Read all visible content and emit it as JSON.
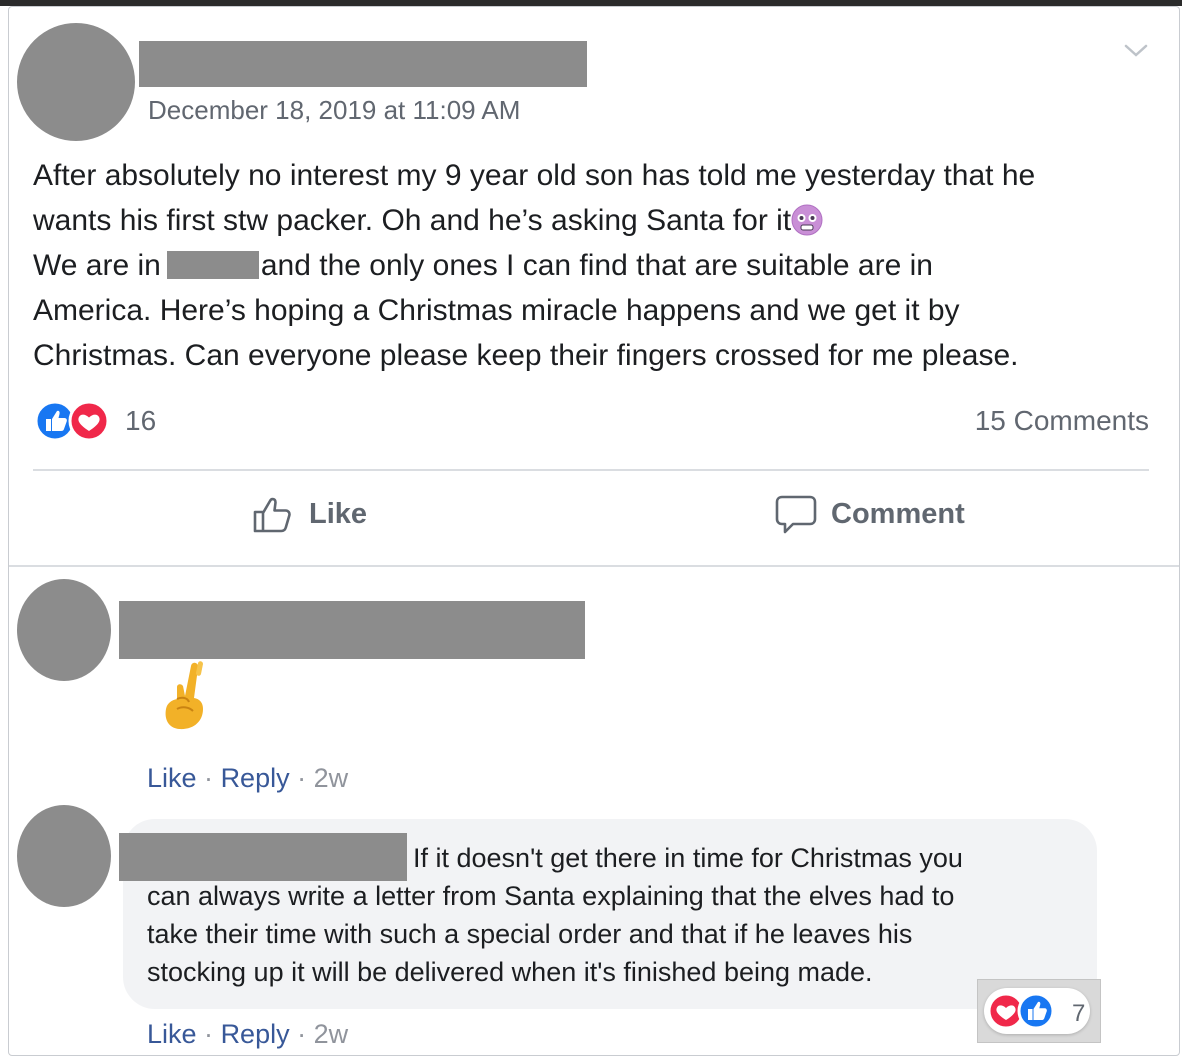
{
  "post": {
    "timestamp": "December 18, 2019 at 11:09 AM",
    "body": {
      "line1": "After absolutely no interest my 9 year old son has told me yesterday that he",
      "line2": "wants his first stw packer. Oh and he’s asking Santa for it",
      "line3_before": "We are in",
      "line3_after": "and the only ones I can find that are suitable are in",
      "line4": "America. Here’s hoping a Christmas miracle happens and we get it by",
      "line5": "Christmas. Can everyone please keep their fingers crossed for me please."
    },
    "reaction_count": "16",
    "comments_count": "15 Comments",
    "like_label": "Like",
    "comment_label": "Comment"
  },
  "comments": [
    {
      "content_emoji": "crossed-fingers",
      "like_label": "Like",
      "reply_label": "Reply",
      "age": "2w",
      "sep": "·"
    },
    {
      "text": {
        "line1": "If it doesn't get there in time for Christmas you",
        "line2": "can always write a letter from Santa explaining that the elves had to",
        "line3": "take their time with such a special order and that if he leaves his",
        "line4": "stocking up it will be delivered when it's finished being made."
      },
      "reaction_count": "7",
      "like_label": "Like",
      "reply_label": "Reply",
      "age": "2w",
      "sep": "·"
    }
  ],
  "colors": {
    "like_blue": "#1877f2",
    "love_red": "#f0284a",
    "link_blue": "#385898",
    "meta_gray": "#90949c",
    "redaction_gray": "#8c8c8c"
  }
}
